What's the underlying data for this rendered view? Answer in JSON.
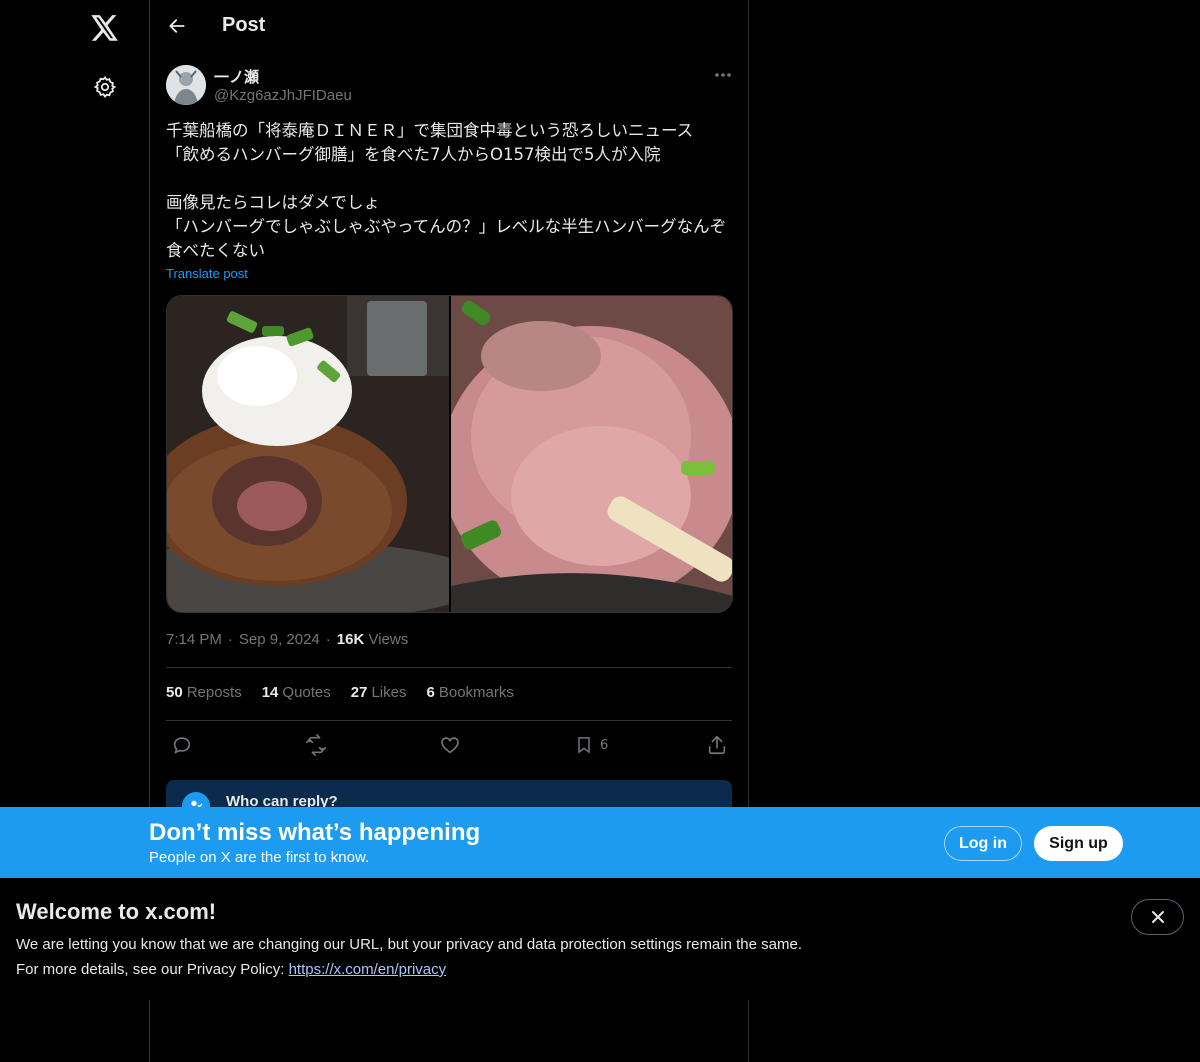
{
  "nav": {
    "logo_icon": "x-logo-icon",
    "settings_icon": "gear-icon"
  },
  "header": {
    "title": "Post",
    "back_icon": "arrow-left-icon"
  },
  "post": {
    "author": {
      "display_name": "一ノ瀬",
      "handle": "@Kzg6azJhJFIDaeu"
    },
    "text_lines": [
      "千葉船橋の「将泰庵ＤＩＮＥＲ」で集団食中毒という恐ろしいニュース\n「飲めるハンバーグ御膳」を食べた7人からO157検出で5人が入院",
      "画像見たらコレはダメでしょ\n「ハンバーグでしゃぶしゃぶやってんの？」レベルな半生ハンバーグなんぞ食べたくない"
    ],
    "translate_label": "Translate post",
    "media": [
      {
        "alt": "hamburger-steak-with-grated-radish"
      },
      {
        "alt": "raw-hamburger-interior-closeup"
      }
    ],
    "time": "7:14 PM",
    "date": "Sep 9, 2024",
    "views_count": "16K",
    "views_label": "Views",
    "stats": {
      "reposts_count": "50",
      "reposts_label": "Reposts",
      "quotes_count": "14",
      "quotes_label": "Quotes",
      "likes_count": "27",
      "likes_label": "Likes",
      "bookmarks_count": "6",
      "bookmarks_label": "Bookmarks"
    },
    "actions": {
      "bookmark_count": "6"
    },
    "who_can_reply": "Who can reply?"
  },
  "banner": {
    "title": "Don’t miss what’s happening",
    "subtitle": "People on X are the first to know.",
    "login_label": "Log in",
    "signup_label": "Sign up"
  },
  "welcome": {
    "title": "Welcome to x.com!",
    "line1": "We are letting you know that we are changing our URL, but your privacy and data protection settings remain the same.",
    "line2_prefix": "For more details, see our Privacy Policy: ",
    "link_text": "https://x.com/en/privacy"
  },
  "colors": {
    "accent": "#1d9bf0",
    "background": "#000000",
    "text": "#e7e9ea",
    "muted": "#71767b",
    "border": "#2f3336"
  }
}
